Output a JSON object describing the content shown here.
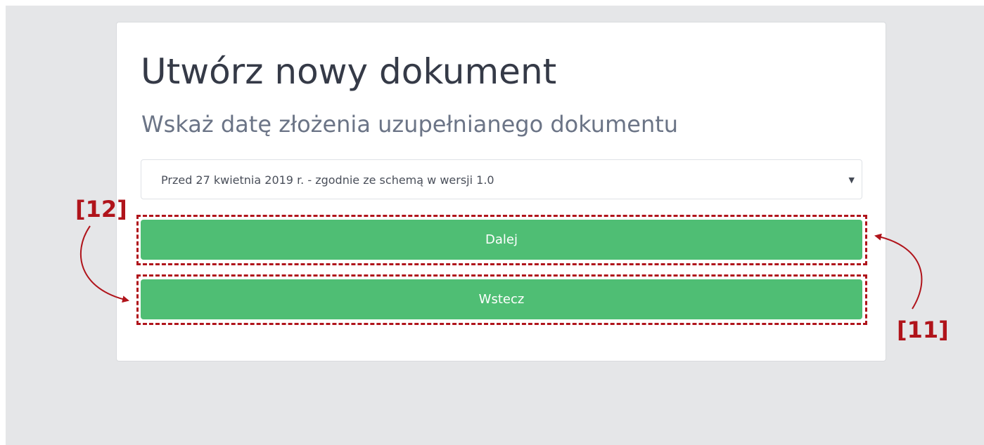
{
  "page": {
    "title": "Utwórz nowy dokument",
    "subtitle": "Wskaż datę złożenia uzupełnianego dokumentu"
  },
  "form": {
    "version_select": {
      "selected": "Przed 27 kwietnia 2019 r. - zgodnie ze schemą w wersji 1.0"
    },
    "next_label": "Dalej",
    "back_label": "Wstecz"
  },
  "annotations": {
    "label_12": "[12]",
    "label_11": "[11]"
  },
  "colors": {
    "button_green": "#4fbe74",
    "annotation_red": "#b0141b",
    "background": "#e5e6e8"
  }
}
